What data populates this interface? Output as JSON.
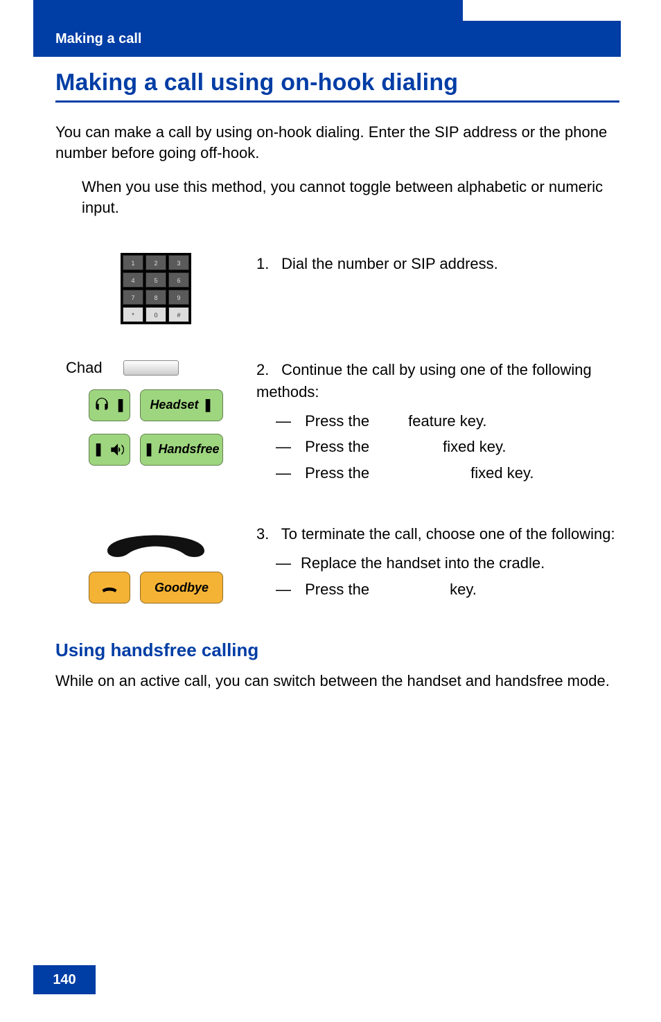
{
  "header": {
    "chapter": "Making a call"
  },
  "title": "Making a call using on-hook dialing",
  "intro": "You can make a call by using on-hook dialing. Enter the SIP address or the phone number before going off-hook.",
  "note": "When you use this method, you cannot toggle between alphabetic or numeric input.",
  "steps": {
    "s1": {
      "num": "1.",
      "text": "Dial the number or SIP address."
    },
    "s2": {
      "num": "2.",
      "text": "Continue the call by using one of the following methods:",
      "items": {
        "a": {
          "pre": "Press the ",
          "post": " feature key."
        },
        "b": {
          "pre": "Press the ",
          "post": " fixed key."
        },
        "c": {
          "pre": "Press the ",
          "post": " fixed key."
        }
      },
      "left": {
        "chad": "Chad",
        "headset": "Headset",
        "handsfree": "Handsfree"
      }
    },
    "s3": {
      "num": "3.",
      "text": "To terminate the call, choose one of the following:",
      "items": {
        "a": "Replace the handset into the cradle.",
        "b": {
          "pre": "Press the ",
          "post": " key."
        }
      },
      "left": {
        "goodbye": "Goodbye"
      }
    }
  },
  "subsection": {
    "title": "Using handsfree calling",
    "body": "While on an active call, you can switch between the handset and handsfree mode."
  },
  "page_number": "140",
  "keypad": [
    "1",
    "2",
    "3",
    "4",
    "5",
    "6",
    "7",
    "8",
    "9",
    "*",
    "0",
    "#"
  ]
}
